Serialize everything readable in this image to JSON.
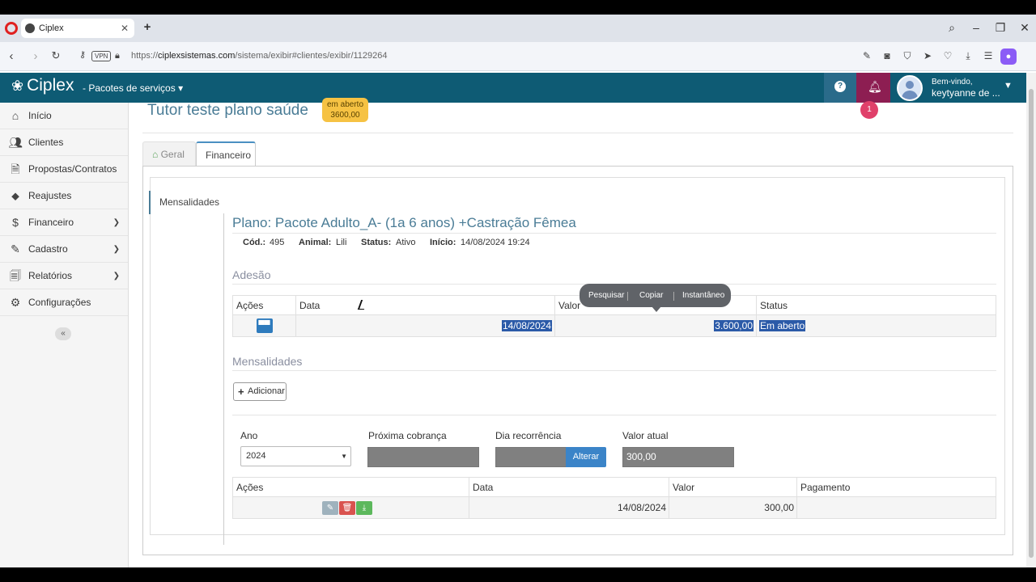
{
  "browser": {
    "tab_title": "Ciplex",
    "url_prefix": "https://",
    "url_domain": "ciplexsistemas.com",
    "url_path": "/sistema/exibir#clientes/exibir/1129264",
    "vpn_label": "VPN"
  },
  "header": {
    "brand": "Ciplex",
    "package_menu": "- Pacotes de serviços",
    "welcome": "Bem-vindo,",
    "user_name": "keytyanne de ...",
    "notification_count": "1"
  },
  "sidebar": {
    "items": [
      {
        "label": "Início",
        "icon": "home-icon"
      },
      {
        "label": "Clientes",
        "icon": "users-icon"
      },
      {
        "label": "Propostas/Contratos",
        "icon": "document-icon"
      },
      {
        "label": "Reajustes",
        "icon": "tags-icon"
      },
      {
        "label": "Financeiro",
        "icon": "dollar-icon"
      },
      {
        "label": "Cadastro",
        "icon": "edit-icon"
      },
      {
        "label": "Relatórios",
        "icon": "report-icon"
      },
      {
        "label": "Configurações",
        "icon": "gears-icon"
      }
    ]
  },
  "page": {
    "title": "Tutor teste plano saúde",
    "status_badge_line1": "em aberto",
    "status_badge_line2": "3600,00",
    "tabs": [
      "Geral",
      "Financeiro"
    ],
    "side_tab": "Mensalidades"
  },
  "plan": {
    "title": "Plano: Pacote Adulto_A- (1a 6 anos) +Castração Fêmea",
    "cod_label": "Cód.:",
    "cod": "495",
    "animal_label": "Animal:",
    "animal": "Lili",
    "status_label": "Status:",
    "status": "Ativo",
    "inicio_label": "Início:",
    "inicio": "14/08/2024 19:24"
  },
  "adesao": {
    "section_title": "Adesão",
    "headers": [
      "Ações",
      "Data",
      "Valor",
      "Status"
    ],
    "row": {
      "data": "14/08/2024",
      "valor": "3.600,00",
      "status": "Em aberto"
    }
  },
  "popover": {
    "items": [
      "Pesquisar",
      "Copiar",
      "Instantâneo"
    ]
  },
  "mensalidades": {
    "section_title": "Mensalidades",
    "add_button": "Adicionar",
    "ano_label": "Ano",
    "ano_value": "2024",
    "proxima_label": "Próxima cobrança",
    "dia_label": "Dia recorrência",
    "alterar_button": "Alterar",
    "valor_atual_label": "Valor atual",
    "valor_atual": "300,00",
    "headers": [
      "Ações",
      "Data",
      "Valor",
      "Pagamento"
    ],
    "row": {
      "data": "14/08/2024",
      "valor": "300,00",
      "pagamento": ""
    }
  }
}
